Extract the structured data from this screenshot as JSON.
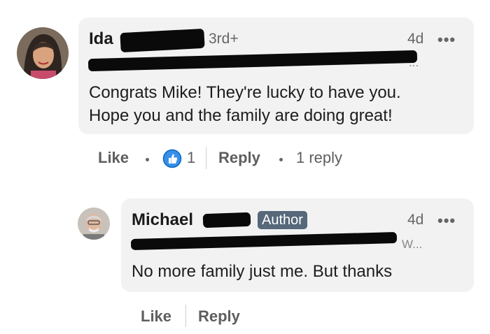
{
  "comment": {
    "author_name": "Ida",
    "degree": "3rd+",
    "time": "4d",
    "more": "•••",
    "headline": "...",
    "text_line1": "Congrats Mike! They're lucky to have you.",
    "text_line2": "Hope you and the family are doing great!",
    "like_label": "Like",
    "reaction_count": "1",
    "reply_label": "Reply",
    "replies_label": "1 reply",
    "accent_color": "#378fe9"
  },
  "reply": {
    "author_name": "Michael",
    "author_badge": "Author",
    "time": "4d",
    "more": "•••",
    "headline": "W...",
    "text": "No more family just me. But thanks",
    "like_label": "Like",
    "reply_label": "Reply",
    "badge_color": "#56687a"
  }
}
